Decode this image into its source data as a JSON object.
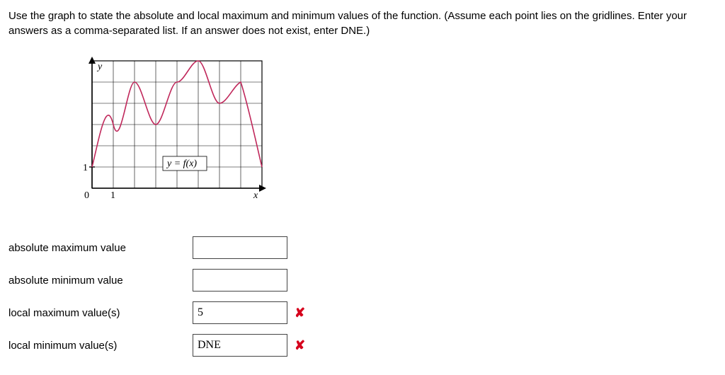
{
  "instructions": "Use the graph to state the absolute and local maximum and minimum values of the function. (Assume each point lies on the gridlines. Enter your answers as a comma-separated list. If an answer does not exist, enter DNE.)",
  "graph": {
    "y_axis_label": "y",
    "x_axis_label": "x",
    "origin_label": "0",
    "x_tick_label": "1",
    "y_tick_label": "1",
    "function_label": "y = f(x)"
  },
  "answers": {
    "abs_max": {
      "label": "absolute maximum value",
      "value": "",
      "mark": ""
    },
    "abs_min": {
      "label": "absolute minimum value",
      "value": "",
      "mark": ""
    },
    "loc_max": {
      "label": "local maximum value(s)",
      "value": "5",
      "mark": "✘"
    },
    "loc_min": {
      "label": "local minimum value(s)",
      "value": "DNE",
      "mark": "✘"
    }
  },
  "chart_data": {
    "type": "line",
    "title": "",
    "xlabel": "x",
    "ylabel": "y",
    "xlim": [
      0,
      8
    ],
    "ylim": [
      0,
      6
    ],
    "x_ticks_labeled": [
      0,
      1
    ],
    "y_ticks_labeled": [
      1
    ],
    "function_label": "y = f(x)",
    "series": [
      {
        "name": "f(x)",
        "x": [
          0,
          1,
          2,
          3,
          4,
          5,
          6,
          7,
          8
        ],
        "values": [
          1,
          3,
          5,
          3,
          5,
          6,
          4,
          5,
          1
        ]
      }
    ],
    "grid": true
  }
}
